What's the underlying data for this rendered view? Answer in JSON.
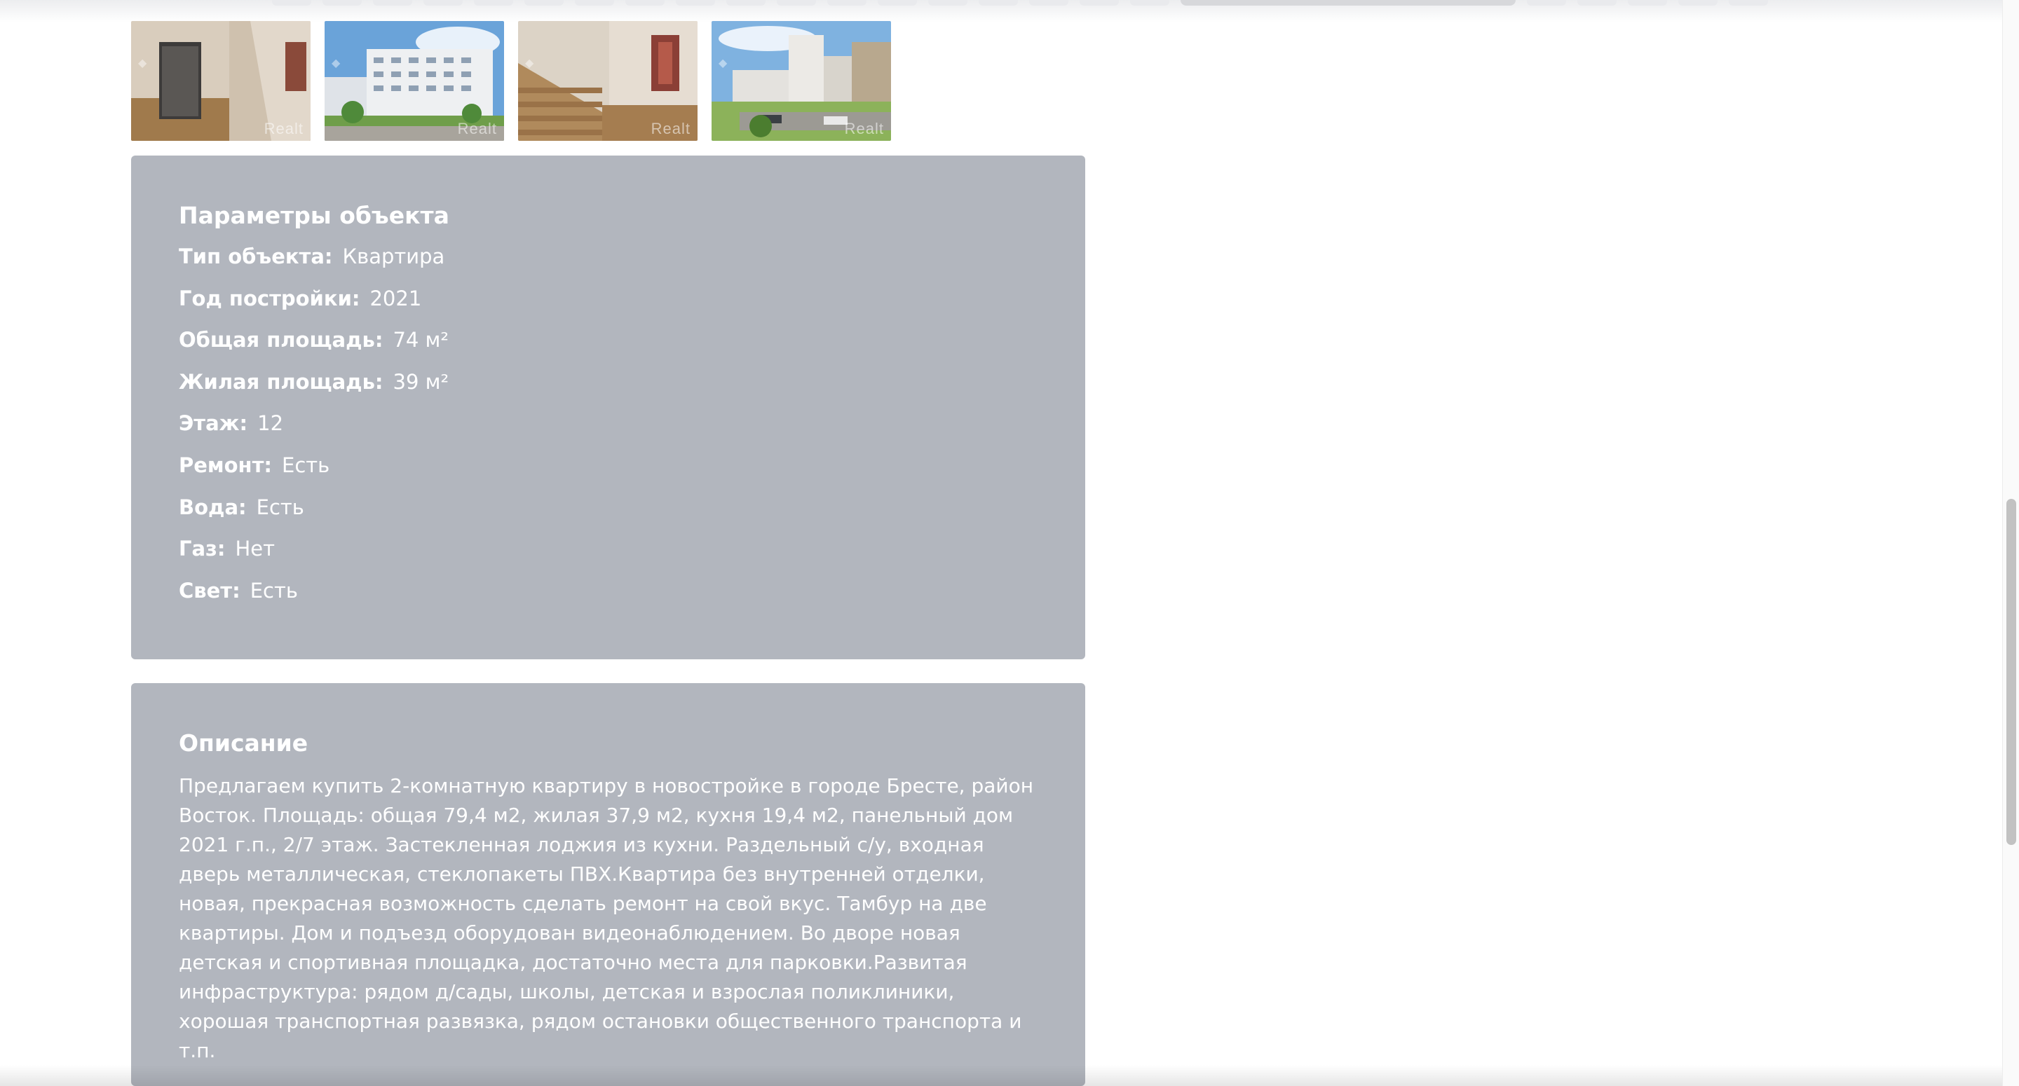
{
  "thumbnails": [
    {
      "alt": "Подъезд",
      "watermark": "Realt",
      "kind": "interior"
    },
    {
      "alt": "Дом",
      "watermark": "Realt",
      "kind": "exterior"
    },
    {
      "alt": "Лестница",
      "watermark": "Realt",
      "kind": "stairs"
    },
    {
      "alt": "Двор",
      "watermark": "Realt",
      "kind": "street"
    }
  ],
  "params": {
    "title": "Параметры объекта",
    "items": [
      {
        "label": "Тип объекта:",
        "value": "Квартира"
      },
      {
        "label": "Год постройки:",
        "value": "2021"
      },
      {
        "label": "Общая площадь:",
        "value": "74 м²"
      },
      {
        "label": "Жилая площадь:",
        "value": "39 м²"
      },
      {
        "label": "Этаж:",
        "value": "12"
      },
      {
        "label": "Ремонт:",
        "value": "Есть"
      },
      {
        "label": "Вода:",
        "value": "Есть"
      },
      {
        "label": "Газ:",
        "value": "Нет"
      },
      {
        "label": "Свет:",
        "value": "Есть"
      }
    ]
  },
  "description": {
    "title": "Описание",
    "text": "Предлагаем купить 2-комнатную квартиру в новостройке в городе Бресте, район Восток. Площадь: общая 79,4 м2, жилая 37,9 м2, кухня 19,4 м2, панельный дом 2021 г.п., 2/7 этаж. Застекленная лоджия из кухни. Раздельный с/у, входная дверь металлическая, стеклопакеты ПВХ.Квартира без внутренней отделки, новая, прекрасная возможность сделать ремонт на свой вкус. Тамбур на две квартиры. Дом и подъезд оборудован видеонаблюдением. Во дворе новая детская и спортивная площадка, достаточно места для парковки.Развитая инфраструктура: рядом д/сады, школы, детская и взрослая поликлиники, хорошая транспортная развязка, рядом остановки общественного транспорта и т.п."
  },
  "colors": {
    "card_bg": "#b2b6be",
    "text": "#ffffff",
    "page_bg": "#ffffff"
  }
}
